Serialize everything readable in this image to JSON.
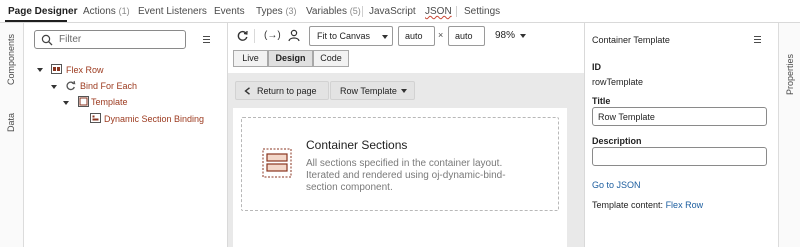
{
  "tabs": [
    {
      "label": "Page Designer",
      "count": ""
    },
    {
      "label": "Actions",
      "count": "(1)"
    },
    {
      "label": "Event Listeners",
      "count": ""
    },
    {
      "label": "Events",
      "count": ""
    },
    {
      "label": "Types",
      "count": "(3)"
    },
    {
      "label": "Variables",
      "count": "(5)"
    },
    {
      "label": "JavaScript",
      "count": ""
    },
    {
      "label": "JSON",
      "count": ""
    },
    {
      "label": "Settings",
      "count": ""
    }
  ],
  "left_strip": {
    "components": "Components",
    "data": "Data"
  },
  "structure": {
    "filter_placeholder": "Filter",
    "tree": [
      {
        "label": "Flex Row",
        "icon": "flex-row-icon"
      },
      {
        "label": "Bind For Each",
        "icon": "loop-icon"
      },
      {
        "label": "Template",
        "icon": "template-icon"
      },
      {
        "label": "Dynamic Section Binding",
        "icon": "dynamic-section-icon"
      }
    ]
  },
  "toolbar": {
    "fit_label": "Fit to Canvas",
    "width_value": "auto",
    "times": "×",
    "height_value": "auto",
    "zoom": "98%",
    "modes": [
      "Live",
      "Design",
      "Code"
    ],
    "selected_mode": "Design"
  },
  "canvas": {
    "back_label": "Return to page",
    "template_label": "Row Template",
    "section_title": "Container Sections",
    "section_desc_1": "All sections specified in the container layout.",
    "section_desc_2": "Iterated and rendered using oj-dynamic-bind-",
    "section_desc_3": "section component."
  },
  "properties": {
    "header": "Container Template",
    "id_label": "ID",
    "id_value": "rowTemplate",
    "title_label": "Title",
    "title_value": "Row Template",
    "desc_label": "Description",
    "desc_value": "",
    "go_json": "Go to JSON",
    "template_content_label": "Template content:",
    "template_content_link": "Flex Row",
    "vertical_tab": "Properties"
  },
  "colors": {
    "tree_text": "#9c3a1f",
    "link": "#1a5c9e",
    "warning_underline": "#c74634"
  }
}
